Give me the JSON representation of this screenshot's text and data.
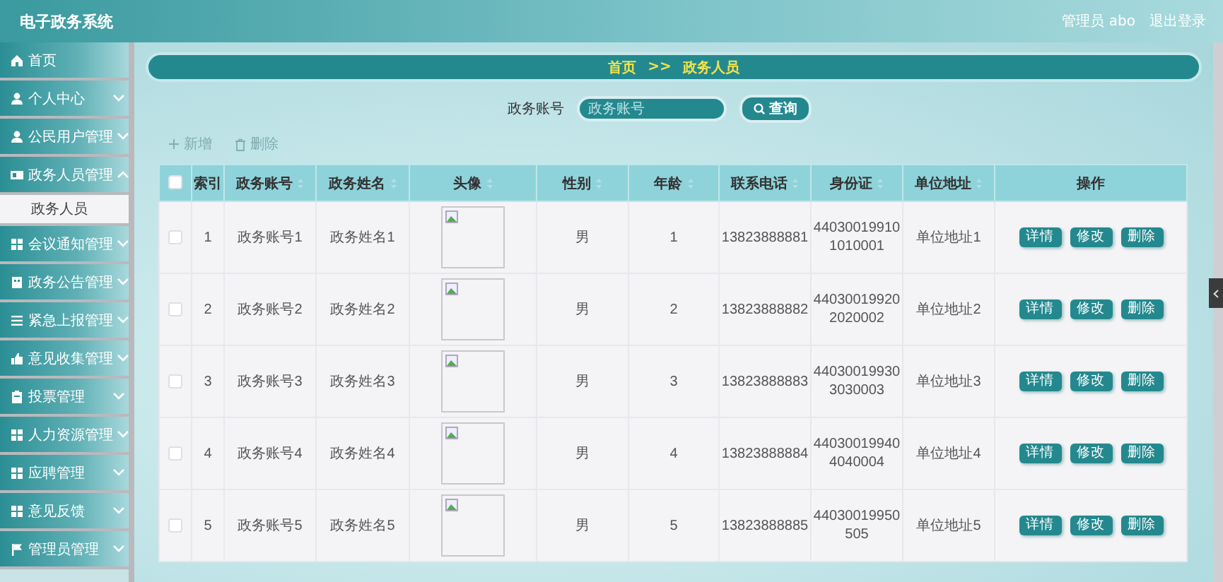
{
  "header": {
    "title": "电子政务系统",
    "user": "管理员 abo",
    "logout": "退出登录"
  },
  "sidebar": {
    "items": [
      {
        "label": "首页",
        "kind": "link"
      },
      {
        "label": "个人中心",
        "kind": "menu",
        "expanded": false
      },
      {
        "label": "公民用户管理",
        "kind": "menu",
        "expanded": false
      },
      {
        "label": "政务人员管理",
        "kind": "menu",
        "expanded": true,
        "children": [
          {
            "label": "政务人员",
            "selected": true
          }
        ]
      },
      {
        "label": "会议通知管理",
        "kind": "menu",
        "expanded": false
      },
      {
        "label": "政务公告管理",
        "kind": "menu",
        "expanded": false
      },
      {
        "label": "紧急上报管理",
        "kind": "menu",
        "expanded": false
      },
      {
        "label": "意见收集管理",
        "kind": "menu",
        "expanded": false
      },
      {
        "label": "投票管理",
        "kind": "menu",
        "expanded": false
      },
      {
        "label": "人力资源管理",
        "kind": "menu",
        "expanded": false
      },
      {
        "label": "应聘管理",
        "kind": "menu",
        "expanded": false
      },
      {
        "label": "意见反馈",
        "kind": "menu",
        "expanded": false
      },
      {
        "label": "管理员管理",
        "kind": "menu",
        "expanded": false
      }
    ]
  },
  "breadcrumb": {
    "items": [
      "首页",
      "政务人员"
    ],
    "separator": ">>"
  },
  "search": {
    "label": "政务账号",
    "placeholder": "政务账号",
    "button": "查询"
  },
  "toolbar": {
    "add": "新增",
    "delete": "删除"
  },
  "table": {
    "select_all": {
      "checked": false
    },
    "columns": [
      {
        "label": "索引",
        "kind": "text",
        "sortable": false
      },
      {
        "label": "政务账号",
        "kind": "text",
        "sortable": true
      },
      {
        "label": "政务姓名",
        "kind": "text",
        "sortable": true
      },
      {
        "label": "头像",
        "kind": "image",
        "sortable": true
      },
      {
        "label": "性别",
        "kind": "text",
        "sortable": true
      },
      {
        "label": "年龄",
        "kind": "text",
        "sortable": true
      },
      {
        "label": "联系电话",
        "kind": "text",
        "sortable": true
      },
      {
        "label": "身份证",
        "kind": "text",
        "sortable": true
      },
      {
        "label": "单位地址",
        "kind": "text",
        "sortable": true
      },
      {
        "label": "操作",
        "kind": "actions",
        "sortable": false
      }
    ],
    "rows": [
      {
        "checked": false,
        "cells": [
          "1",
          "政务账号1",
          "政务姓名1",
          "",
          "男",
          "1",
          "13823888881",
          "440300199101010001",
          "单位地址1"
        ],
        "actions": [
          "详情",
          "修改",
          "删除"
        ]
      },
      {
        "checked": false,
        "cells": [
          "2",
          "政务账号2",
          "政务姓名2",
          "",
          "男",
          "2",
          "13823888882",
          "440300199202020002",
          "单位地址2"
        ],
        "actions": [
          "详情",
          "修改",
          "删除"
        ]
      },
      {
        "checked": false,
        "cells": [
          "3",
          "政务账号3",
          "政务姓名3",
          "",
          "男",
          "3",
          "13823888883",
          "440300199303030003",
          "单位地址3"
        ],
        "actions": [
          "详情",
          "修改",
          "删除"
        ]
      },
      {
        "checked": false,
        "cells": [
          "4",
          "政务账号4",
          "政务姓名4",
          "",
          "男",
          "4",
          "13823888884",
          "440300199404040004",
          "单位地址4"
        ],
        "actions": [
          "详情",
          "修改",
          "删除"
        ]
      },
      {
        "checked": false,
        "cells": [
          "5",
          "政务账号5",
          "政务姓名5",
          "",
          "男",
          "5",
          "13823888885",
          "44030019950505",
          "单位地址5"
        ],
        "actions": [
          "详情",
          "修改",
          "删除"
        ]
      }
    ]
  }
}
